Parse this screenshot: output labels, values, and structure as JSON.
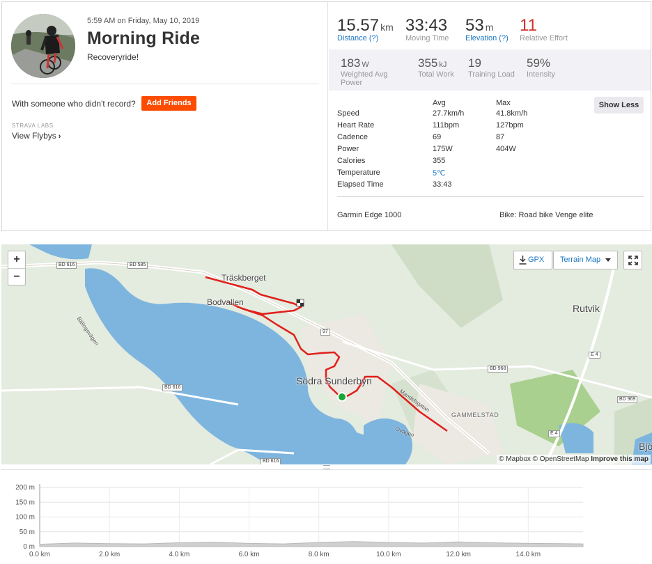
{
  "activity": {
    "datetime": "5:59 AM on Friday, May 10, 2019",
    "title": "Morning Ride",
    "description": "Recoveryride!",
    "who_text": "With someone who didn't record?",
    "add_friends_label": "Add Friends",
    "labs_tag": "STRAVA LABS",
    "flybys_label": "View Flybys"
  },
  "primary_stats": [
    {
      "value": "15.57",
      "unit": "km",
      "label": "Distance (?)",
      "link": true
    },
    {
      "value": "33:43",
      "unit": "",
      "label": "Moving Time",
      "link": false
    },
    {
      "value": "53",
      "unit": "m",
      "label": "Elevation (?)",
      "link": true
    },
    {
      "value": "11",
      "unit": "",
      "label": "Relative Effort",
      "link": false
    }
  ],
  "secondary_stats": [
    {
      "value": "183",
      "unit": "W",
      "label_line1": "Weighted Avg",
      "label_line2": "Power"
    },
    {
      "value": "355",
      "unit": "kJ",
      "label_line1": "Total Work",
      "label_line2": ""
    },
    {
      "value": "19",
      "unit": "",
      "label_line1": "Training Load",
      "label_line2": ""
    },
    {
      "value": "59%",
      "unit": "",
      "label_line1": "Intensity",
      "label_line2": ""
    }
  ],
  "details": {
    "show_less_label": "Show Less",
    "col_avg": "Avg",
    "col_max": "Max",
    "rows": [
      {
        "name": "Speed",
        "avg": "27.7km/h",
        "max": "41.8km/h"
      },
      {
        "name": "Heart Rate",
        "avg": "111bpm",
        "max": "127bpm"
      },
      {
        "name": "Cadence",
        "avg": "69",
        "max": "87"
      },
      {
        "name": "Power",
        "avg": "175W",
        "max": "404W"
      },
      {
        "name": "Calories",
        "avg": "355",
        "max": ""
      },
      {
        "name": "Temperature",
        "avg": "5℃",
        "max": ""
      },
      {
        "name": "Elapsed Time",
        "avg": "33:43",
        "max": ""
      }
    ],
    "device": "Garmin Edge 1000",
    "bike": "Bike: Road bike Venge elite"
  },
  "map": {
    "zoom_in": "+",
    "zoom_out": "−",
    "gpx_label": "GPX",
    "terrain_label": "Terrain Map",
    "attribution_1": "© Mapbox © OpenStreetMap",
    "attribution_2": "Improve this map",
    "place_labels": [
      "Träskberget",
      "Bodvallen",
      "Södra Sunderbyn",
      "Rutvik",
      "GAMMELSTAD",
      "Bjö"
    ],
    "road_labels": [
      "BD 616",
      "BD 585",
      "97",
      "BD 616",
      "BD 616",
      "BD 968",
      "E 4",
      "BD 969",
      "E 4"
    ],
    "street_labels": [
      "Bälingsvägen",
      "Ovägen",
      "Mandelsgatan"
    ],
    "colors": {
      "water": "#7db5df",
      "route": "#e0201b",
      "start": "#1aa537"
    }
  },
  "elevation": {
    "y_ticks": [
      "200 m",
      "150 m",
      "100 m",
      "50 m",
      "0 m"
    ],
    "x_ticks": [
      "0.0 km",
      "2.0 km",
      "4.0 km",
      "6.0 km",
      "8.0 km",
      "10.0 km",
      "12.0 km",
      "14.0 km"
    ]
  },
  "chart_data": {
    "type": "area",
    "title": "",
    "xlabel": "",
    "ylabel": "",
    "ylim": [
      0,
      200
    ],
    "xlim": [
      0,
      15.57
    ],
    "x": [
      0,
      1,
      2,
      3,
      4,
      5,
      6,
      7,
      8,
      9,
      10,
      11,
      12,
      13,
      14,
      15,
      15.57
    ],
    "series": [
      {
        "values": [
          8,
          12,
          10,
          9,
          13,
          15,
          11,
          9,
          14,
          17,
          14,
          12,
          16,
          13,
          11,
          10,
          9
        ]
      }
    ]
  }
}
